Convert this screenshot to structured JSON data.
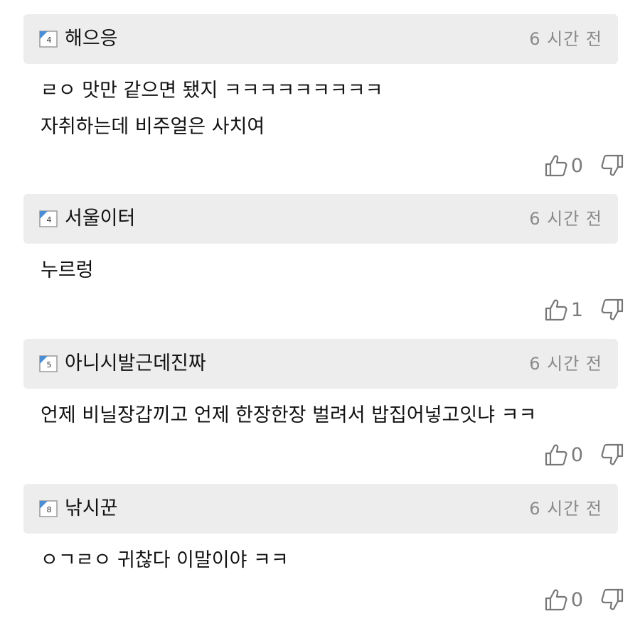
{
  "comments": [
    {
      "level": "4",
      "nickname": "해으응",
      "time": "6 시간 전",
      "lines": [
        "ㄹㅇ 맛만 같으면 됐지 ㅋㅋㅋㅋㅋㅋㅋㅋㅋ",
        "자취하는데 비주얼은 사치여"
      ],
      "likes": "0"
    },
    {
      "level": "4",
      "nickname": "서울이터",
      "time": "6 시간 전",
      "lines": [
        "누르렁"
      ],
      "likes": "1"
    },
    {
      "level": "5",
      "nickname": "아니시발근데진짜",
      "time": "6 시간 전",
      "lines": [
        "언제 비닐장갑끼고 언제 한장한장 벌려서 밥집어넣고잇냐 ㅋㅋ"
      ],
      "likes": "0"
    },
    {
      "level": "8",
      "nickname": "낚시꾼",
      "time": "6 시간 전",
      "lines": [
        "ㅇㄱㄹㅇ 귀찮다 이말이야 ㅋㅋ"
      ],
      "likes": "0"
    }
  ],
  "colors": {
    "header_bg": "#ededed",
    "level_badge": "#4a8fd6",
    "muted_text": "#8a8a8a"
  }
}
